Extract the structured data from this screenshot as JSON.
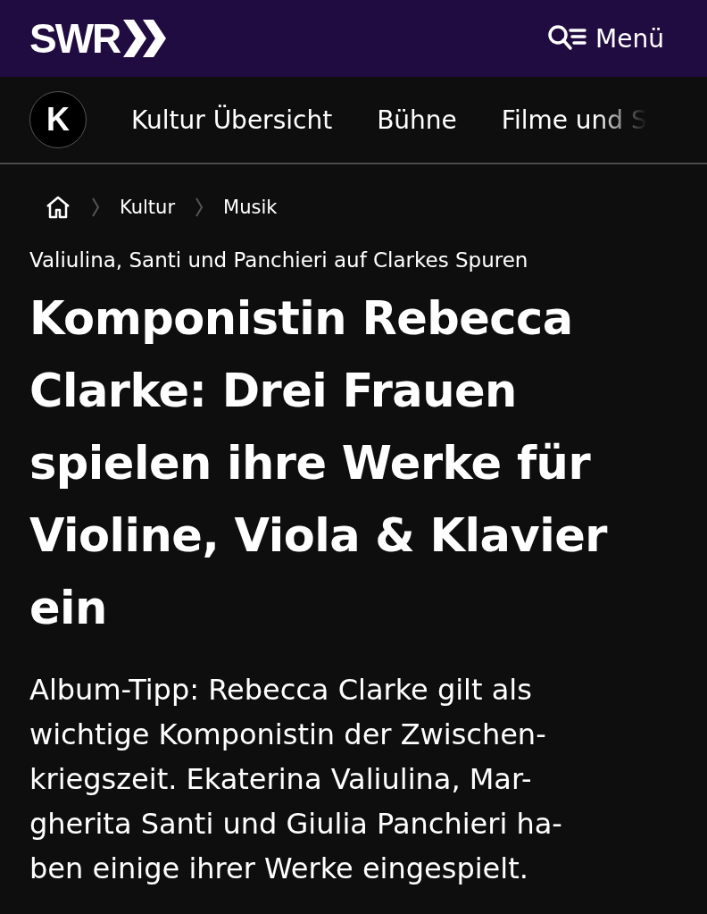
{
  "header": {
    "logo": "SWR",
    "menu_label": "Menü"
  },
  "section_nav": {
    "logo_letter": "K",
    "items": [
      {
        "label": "Kultur Übersicht",
        "faded": false
      },
      {
        "label": "Bühne",
        "faded": false
      },
      {
        "label": "Filme und S",
        "faded": true
      }
    ]
  },
  "breadcrumb": [
    "Kultur",
    "Musik"
  ],
  "article": {
    "kicker": "Valiulina, Santi und Panchieri auf Clarkes Spuren",
    "headline": "Komponistin Rebecca Clarke: Drei Frauen spielen ihre Werke für Violine, Viola & Klavier ein",
    "lead_lines": [
      "Album-Tipp: Rebecca Clarke gilt als",
      "wichtige Komponistin der Zwischen-",
      "kriegszeit. Ekaterina Valiulina, Mar-",
      "gherita Santi und Giulia Panchieri ha-",
      "ben einige ihrer Werke eingespielt."
    ]
  }
}
